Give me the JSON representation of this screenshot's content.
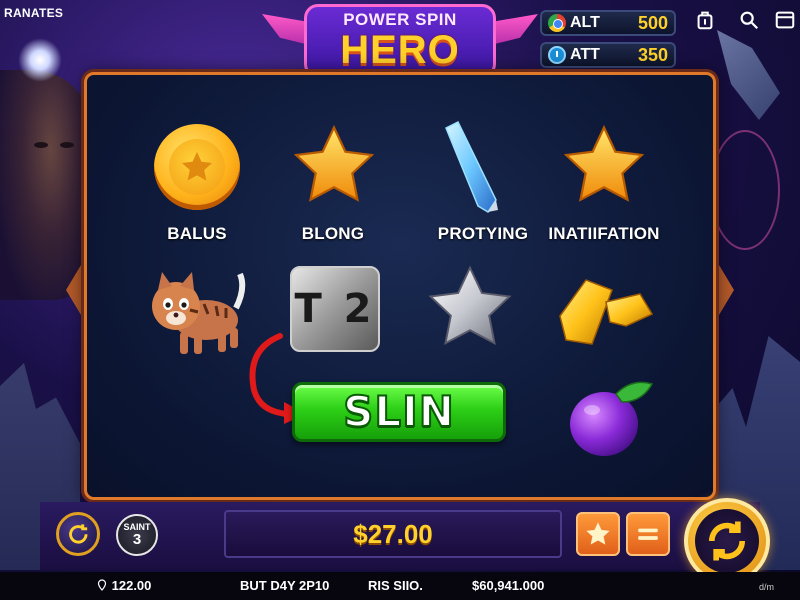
{
  "header": {
    "corner_label": "RANATES",
    "logo": {
      "line1": "POWER SPIN",
      "line2": "HERO"
    },
    "stats": [
      {
        "icon": "chrome-icon",
        "label": "ALT",
        "value": "500"
      },
      {
        "icon": "clock-icon",
        "label": "ATT",
        "value": "350"
      }
    ],
    "icons": [
      "share-icon",
      "search-icon",
      "menu-icon"
    ]
  },
  "reels": {
    "row1": [
      {
        "symbol": "gold-coin-star-icon",
        "label": "BALUS"
      },
      {
        "symbol": "gold-star-icon",
        "label": "BLONG"
      },
      {
        "symbol": "blue-crystal-icon",
        "label": "PROTYING"
      },
      {
        "symbol": "gold-star-icon",
        "label": "INATIIFATION"
      }
    ],
    "row2": [
      {
        "symbol": "tiger-cub-icon"
      },
      {
        "symbol": "metal-block-icon",
        "text": "T 2"
      },
      {
        "symbol": "silver-star-icon"
      },
      {
        "symbol": "gold-bars-icon"
      }
    ],
    "row3": [
      {
        "symbol": "purple-fruit-icon"
      }
    ],
    "spin_button_label": "SLIN"
  },
  "controls": {
    "saint": {
      "label": "SAINT",
      "value": "3"
    },
    "win_amount": "$27.00"
  },
  "status_bar": {
    "balance": "122.00",
    "bet_text": "BUT D4Y 2P10",
    "ris_text": "RIS SIIO.",
    "jackpot": "$60,941.000",
    "corner": "d/m"
  },
  "colors": {
    "frame": "#e07a2a",
    "gold": "#ffd12a",
    "spin_green": "#2ccf16",
    "orange_button": "#ff9a3a"
  }
}
